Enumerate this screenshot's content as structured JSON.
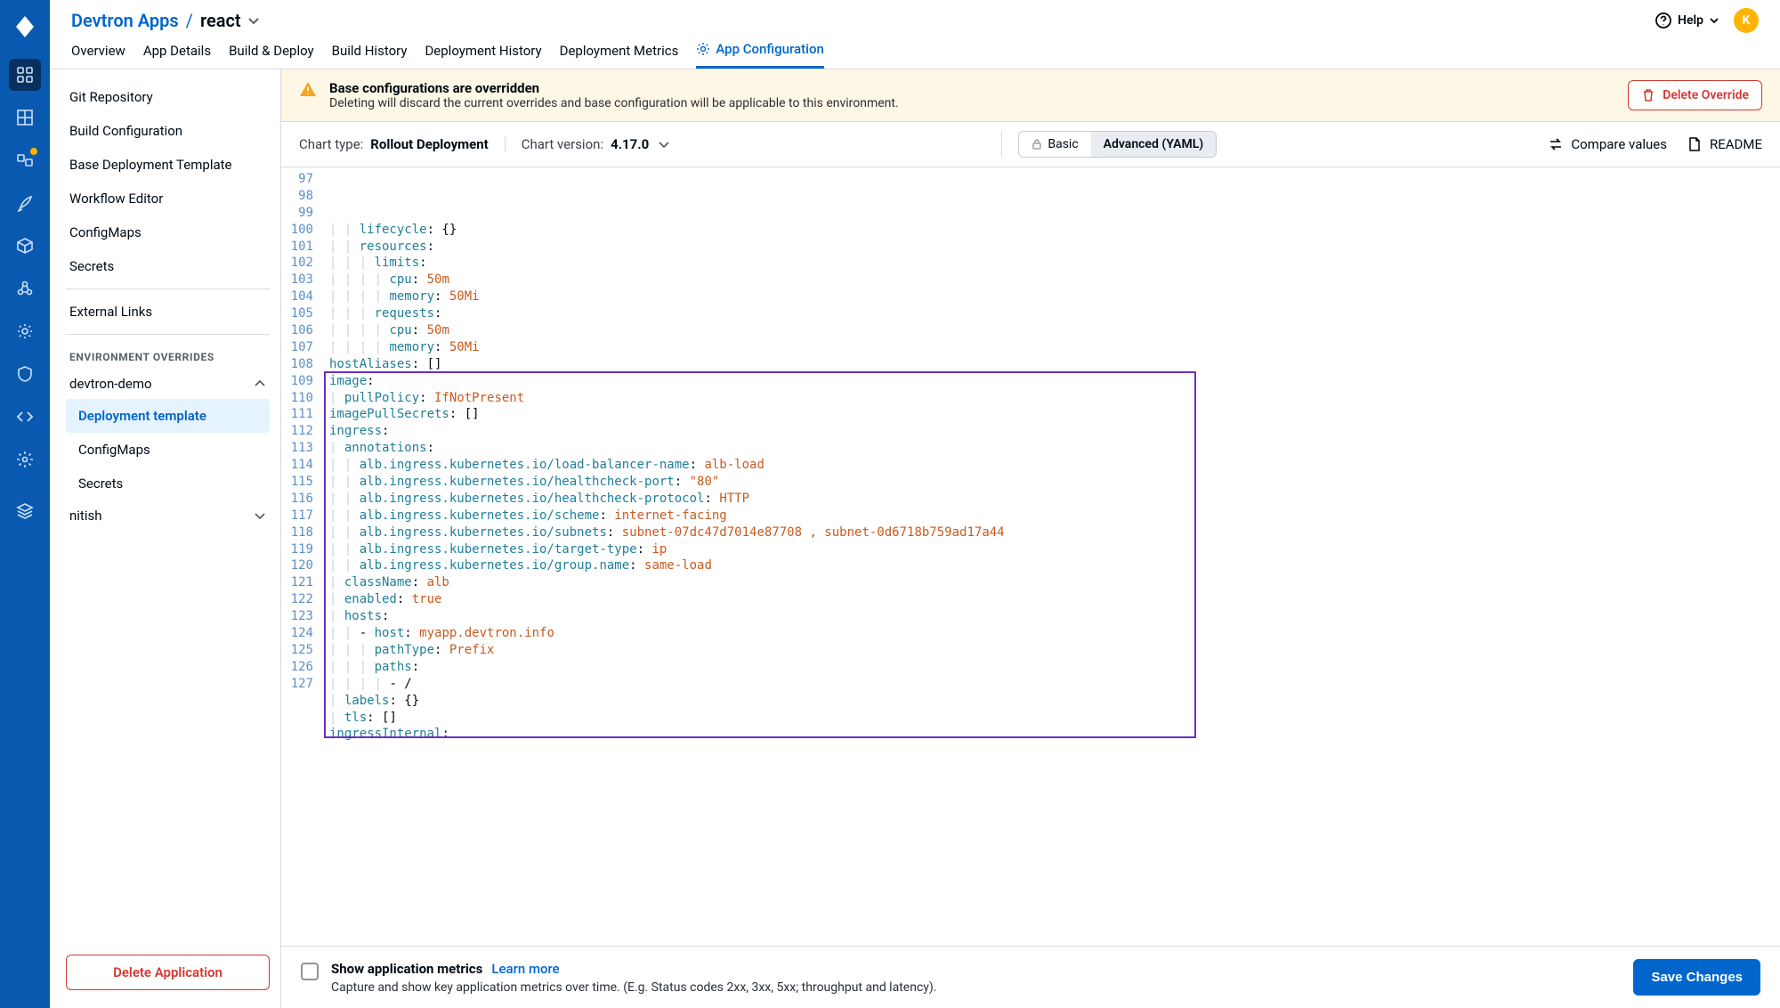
{
  "breadcrumb": {
    "parent": "Devtron Apps",
    "sep": "/",
    "leaf": "react"
  },
  "header": {
    "help_label": "Help",
    "avatar_initial": "K"
  },
  "tabs": [
    {
      "label": "Overview"
    },
    {
      "label": "App Details"
    },
    {
      "label": "Build & Deploy"
    },
    {
      "label": "Build History"
    },
    {
      "label": "Deployment History"
    },
    {
      "label": "Deployment Metrics"
    },
    {
      "label": "App Configuration",
      "active": true
    }
  ],
  "sidebar": {
    "items": [
      {
        "label": "Git Repository"
      },
      {
        "label": "Build Configuration"
      },
      {
        "label": "Base Deployment Template"
      },
      {
        "label": "Workflow Editor"
      },
      {
        "label": "ConfigMaps"
      },
      {
        "label": "Secrets"
      }
    ],
    "external_links_label": "External Links",
    "overrides_heading": "ENVIRONMENT OVERRIDES",
    "envs": [
      {
        "name": "devtron-demo",
        "expanded": true,
        "children": [
          {
            "label": "Deployment template",
            "active": true
          },
          {
            "label": "ConfigMaps"
          },
          {
            "label": "Secrets"
          }
        ]
      },
      {
        "name": "nitish",
        "expanded": false
      }
    ],
    "delete_app_label": "Delete Application"
  },
  "alert": {
    "title": "Base configurations are overridden",
    "subtitle": "Deleting will discard the current overrides and base configuration will be applicable to this environment.",
    "delete_label": "Delete Override"
  },
  "chartbar": {
    "type_label": "Chart type:",
    "type_value": "Rollout Deployment",
    "version_label": "Chart version:",
    "version_value": "4.17.0",
    "basic_label": "Basic",
    "advanced_label": "Advanced (YAML)",
    "compare_label": "Compare values",
    "readme_label": "README"
  },
  "editor": {
    "first_line_number": 97,
    "lines": [
      {
        "indent": 2,
        "key": "lifecycle",
        "after": ": {}"
      },
      {
        "indent": 2,
        "key": "resources",
        "after": ":"
      },
      {
        "indent": 3,
        "key": "limits",
        "after": ":"
      },
      {
        "indent": 4,
        "key": "cpu",
        "after": ": ",
        "val": "50m"
      },
      {
        "indent": 4,
        "key": "memory",
        "after": ": ",
        "val": "50Mi"
      },
      {
        "indent": 3,
        "key": "requests",
        "after": ":"
      },
      {
        "indent": 4,
        "key": "cpu",
        "after": ": ",
        "val": "50m"
      },
      {
        "indent": 4,
        "key": "memory",
        "after": ": ",
        "val": "50Mi"
      },
      {
        "indent": 0,
        "key": "hostAliases",
        "after": ": []"
      },
      {
        "indent": 0,
        "key": "image",
        "after": ":"
      },
      {
        "indent": 1,
        "key": "pullPolicy",
        "after": ": ",
        "val": "IfNotPresent"
      },
      {
        "indent": 0,
        "key": "imagePullSecrets",
        "after": ": []"
      },
      {
        "indent": 0,
        "key": "ingress",
        "after": ":"
      },
      {
        "indent": 1,
        "key": "annotations",
        "after": ":"
      },
      {
        "indent": 2,
        "key": "alb.ingress.kubernetes.io/load-balancer-name",
        "after": ": ",
        "val": "alb-load"
      },
      {
        "indent": 2,
        "key": "alb.ingress.kubernetes.io/healthcheck-port",
        "after": ": ",
        "val": "\"80\""
      },
      {
        "indent": 2,
        "key": "alb.ingress.kubernetes.io/healthcheck-protocol",
        "after": ": ",
        "val": "HTTP"
      },
      {
        "indent": 2,
        "key": "alb.ingress.kubernetes.io/scheme",
        "after": ": ",
        "val": "internet-facing"
      },
      {
        "indent": 2,
        "key": "alb.ingress.kubernetes.io/subnets",
        "after": ": ",
        "val": "subnet-07dc47d7014e87708 , subnet-0d6718b759ad17a44"
      },
      {
        "indent": 2,
        "key": "alb.ingress.kubernetes.io/target-type",
        "after": ": ",
        "val": "ip"
      },
      {
        "indent": 2,
        "key": "alb.ingress.kubernetes.io/group.name",
        "after": ": ",
        "val": "same-load"
      },
      {
        "indent": 1,
        "key": "className",
        "after": ": ",
        "val": "alb"
      },
      {
        "indent": 1,
        "key": "enabled",
        "after": ": ",
        "val": "true"
      },
      {
        "indent": 1,
        "key": "hosts",
        "after": ":"
      },
      {
        "indent": 2,
        "plain": "- ",
        "key": "host",
        "after": ": ",
        "val": "myapp.devtron.info"
      },
      {
        "indent": 3,
        "key": "pathType",
        "after": ": ",
        "val": "Prefix"
      },
      {
        "indent": 3,
        "key": "paths",
        "after": ":"
      },
      {
        "indent": 4,
        "plain": "- /"
      },
      {
        "indent": 1,
        "key": "labels",
        "after": ": {}"
      },
      {
        "indent": 1,
        "key": "tls",
        "after": ": []"
      },
      {
        "indent": 0,
        "key": "ingressInternal",
        "after": ":"
      }
    ]
  },
  "footer": {
    "metrics_title": "Show application metrics",
    "learn_more": "Learn more",
    "metrics_sub": "Capture and show key application metrics over time. (E.g. Status codes 2xx, 3xx, 5xx; throughput and latency).",
    "save_label": "Save Changes"
  }
}
